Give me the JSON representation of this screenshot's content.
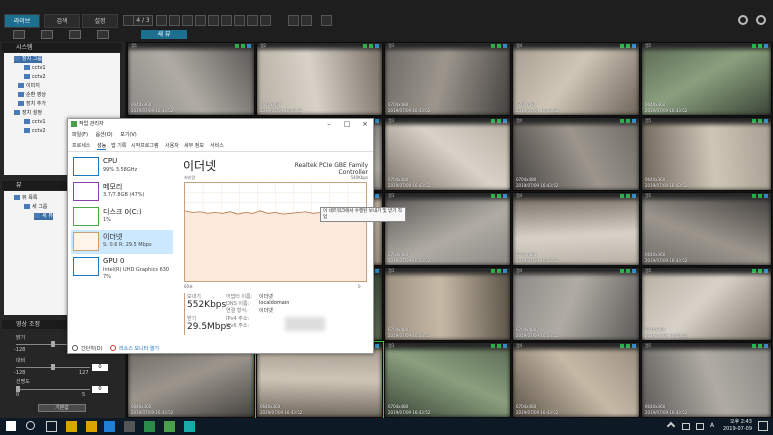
{
  "nav": {
    "tabs": [
      "라이브",
      "검색",
      "설정"
    ],
    "page": "4 / 3"
  },
  "view_tab": "새 뷰",
  "left_panel": {
    "system_header": "시스템",
    "tree_system": [
      {
        "label": "장치 그룹",
        "level": 1,
        "selected": true
      },
      {
        "label": "cctv1",
        "level": 2
      },
      {
        "label": "cctv2",
        "level": 2
      },
      {
        "label": "이미지",
        "level": 1
      },
      {
        "label": "순환 영상",
        "level": 1
      },
      {
        "label": "장치 추가",
        "level": 1
      },
      {
        "label": "장치 설정",
        "level": 1
      },
      {
        "label": "cctv1",
        "level": 2
      },
      {
        "label": "cctv2",
        "level": 2
      }
    ],
    "view_header": "뷰",
    "tree_view": [
      {
        "label": "뷰 목록",
        "level": 1
      },
      {
        "label": "새 그룹",
        "level": 2
      },
      {
        "label": "새 뷰",
        "level": 3,
        "selected": true
      }
    ],
    "adjust_header": "영상 조정",
    "brightness_label": "밝기",
    "brightness_min": "-128",
    "brightness_max": "127",
    "brightness_value": "0",
    "contrast_label": "대비",
    "contrast_min": "-128",
    "contrast_max": "127",
    "contrast_value": "0",
    "sharpness_label": "선명도",
    "sharpness_min": "0",
    "sharpness_max": "5",
    "sharpness_value": "0",
    "default_button": "기본값"
  },
  "task_manager": {
    "title": "작업 관리자",
    "menu": [
      "파일(F)",
      "옵션(O)",
      "보기(V)"
    ],
    "tabs": [
      "프로세스",
      "성능",
      "앱 기록",
      "시작프로그램",
      "사용자",
      "세부 정보",
      "서비스"
    ],
    "resources": [
      {
        "name": "CPU",
        "sub": "99% 3.58GHz"
      },
      {
        "name": "메모리",
        "sub": "3.7/7.8GB (47%)"
      },
      {
        "name": "디스크 0(C:)",
        "sub": "1%"
      },
      {
        "name": "이더넷",
        "sub": "S: 0.6 R: 29.5 Mbps"
      },
      {
        "name": "GPU 0",
        "sub": "Intel(R) UHD Graphics 630",
        "sub2": "7%"
      }
    ],
    "detail_title": "이더넷",
    "adapter": "Realtek PCIe GBE Family Controller",
    "throughput_label": "처리량",
    "max_label": "540Kbps",
    "graph_left": "60초",
    "graph_right": "0",
    "send_label": "보내기",
    "send_value": "552Kbps",
    "recv_label": "받기",
    "recv_value": "29.5Mbps",
    "adapter_name_label": "어댑터 이름:",
    "adapter_name_value": "이더넷",
    "dns_label": "DNS 이름:",
    "dns_value": "localdomain",
    "conn_label": "연결 형식:",
    "conn_value": "이더넷",
    "ipv4_label": "IPv4 주소:",
    "ipv6_label": "IPv6 주소:",
    "footer_simple": "간단히(D)",
    "footer_monitor": "리소스 모니터 열기",
    "graph_series": [
      60,
      58,
      59,
      57,
      58,
      57,
      59,
      56,
      58,
      57,
      60,
      57,
      58,
      56,
      57,
      58,
      59,
      57,
      58,
      56,
      57,
      59,
      58,
      57,
      58
    ]
  },
  "tooltip": "이 네트워크에서 수행된 보내기 및 받기 작업",
  "cameras": {
    "labels": [
      "캠1",
      "캠2",
      "캠3",
      "캠4",
      "캠5"
    ],
    "res_a": "0640x360",
    "res_b": "0704x480",
    "res_c": "0640x360",
    "timestamp": "2019/07/09 16:43:52"
  },
  "clock": {
    "time": "오후 2:43",
    "date": "2019-07-09"
  }
}
